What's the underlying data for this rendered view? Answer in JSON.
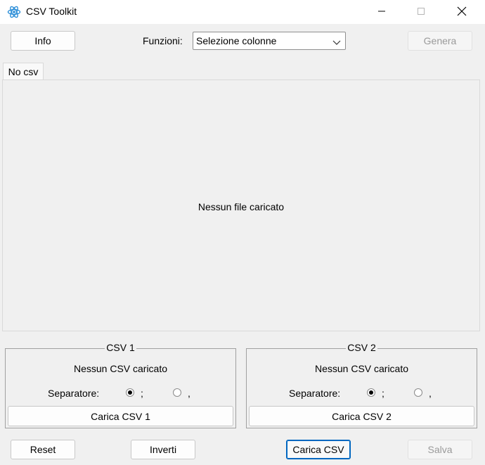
{
  "window": {
    "title": "CSV Toolkit",
    "icon": "atom-icon",
    "controls": [
      "minimize-icon",
      "maximize-icon",
      "close-icon"
    ]
  },
  "toolbar": {
    "info_label": "Info",
    "functions_label": "Funzioni:",
    "functions_selected": "Selezione colonne",
    "generate_label": "Genera"
  },
  "tabs": [
    {
      "label": "No csv"
    }
  ],
  "main": {
    "placeholder": "Nessun file caricato"
  },
  "csv1": {
    "title": "CSV 1",
    "status": "Nessun CSV caricato",
    "separator_label": "Separatore:",
    "options": [
      {
        "label": ";",
        "checked": true
      },
      {
        "label": ",",
        "checked": false
      }
    ],
    "load_label": "Carica CSV 1"
  },
  "csv2": {
    "title": "CSV 2",
    "status": "Nessun CSV caricato",
    "separator_label": "Separatore:",
    "options": [
      {
        "label": ";",
        "checked": true
      },
      {
        "label": ",",
        "checked": false
      }
    ],
    "load_label": "Carica CSV 2"
  },
  "footer": {
    "reset_label": "Reset",
    "invert_label": "Inverti",
    "load_csv_label": "Carica CSV",
    "save_label": "Salva"
  },
  "colors": {
    "accent": "#0067c0",
    "background": "#f0f0f0",
    "titlebar": "#ffffff"
  }
}
